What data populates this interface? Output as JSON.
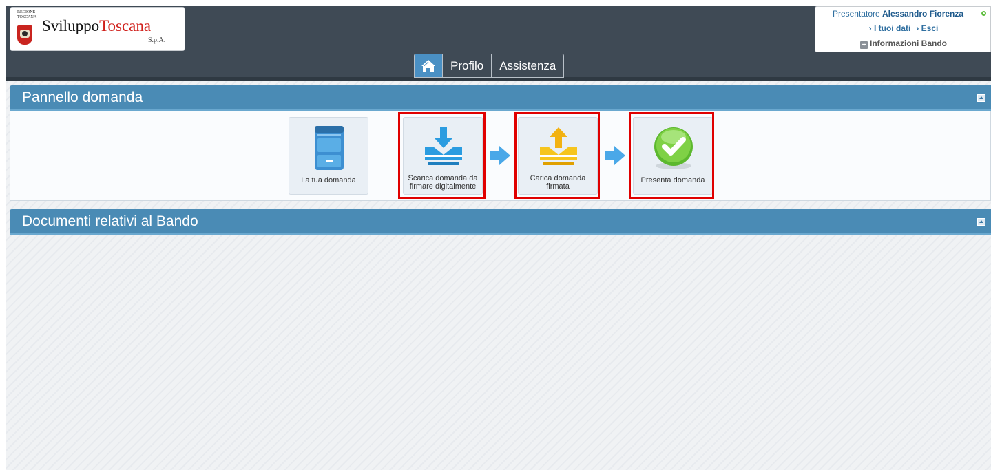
{
  "logo": {
    "region_text": "REGIONE TOSCANA",
    "name_part1": "Sviluppo",
    "name_part2": "Toscana",
    "suffix": "S.p.A."
  },
  "user": {
    "role_label": "Presentatore",
    "name": "Alessandro Fiorenza",
    "link_my_data": "› I tuoi dati",
    "link_exit": "› Esci",
    "info_label": "Informazioni Bando"
  },
  "nav": {
    "home_icon": "home-icon",
    "tabs": [
      {
        "label": "Profilo"
      },
      {
        "label": "Assistenza"
      }
    ]
  },
  "panels": {
    "application": {
      "title": "Pannello domanda"
    },
    "documents": {
      "title": "Documenti relativi al Bando"
    }
  },
  "actions": [
    {
      "label": "La tua domanda",
      "icon": "file-cabinet-icon",
      "highlighted": false
    },
    {
      "label": "Scarica domanda da firmare digitalmente",
      "icon": "download-tray-icon",
      "highlighted": true
    },
    {
      "label": "Carica domanda firmata",
      "icon": "upload-tray-icon",
      "highlighted": true
    },
    {
      "label": "Presenta domanda",
      "icon": "green-check-icon",
      "highlighted": true
    }
  ],
  "colors": {
    "header_bg": "#3f4a55",
    "panel_header": "#4a8bb5",
    "highlight": "#e00000",
    "accent_blue": "#4a90c4",
    "brand_red": "#d0201b"
  }
}
